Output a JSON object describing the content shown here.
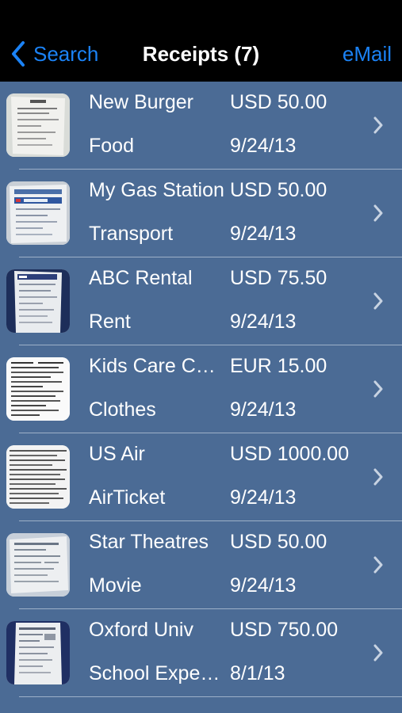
{
  "nav": {
    "back_label": "Search",
    "title": "Receipts (7)",
    "right_label": "eMail"
  },
  "receipts": [
    {
      "merchant": "New Burger",
      "amount": "USD 50.00",
      "category": "Food",
      "date": "9/24/13"
    },
    {
      "merchant": "My Gas Station",
      "amount": "USD 50.00",
      "category": "Transport",
      "date": "9/24/13"
    },
    {
      "merchant": "ABC Rental",
      "amount": "USD 75.50",
      "category": "Rent",
      "date": "9/24/13"
    },
    {
      "merchant": "Kids Care Center",
      "amount": "EUR 15.00",
      "category": "Clothes",
      "date": "9/24/13"
    },
    {
      "merchant": "US Air",
      "amount": "USD 1000.00",
      "category": "AirTicket",
      "date": "9/24/13"
    },
    {
      "merchant": "Star Theatres",
      "amount": "USD 50.00",
      "category": "Movie",
      "date": "9/24/13"
    },
    {
      "merchant": "Oxford Univ",
      "amount": "USD 750.00",
      "category": "School Expenses",
      "date": "8/1/13"
    }
  ],
  "colors": {
    "accent": "#1b82f5",
    "list_background": "#4b6b95",
    "navbar": "#000000"
  },
  "icons": {
    "back": "chevron-left-icon",
    "disclosure": "chevron-right-icon",
    "thumbnail": "receipt-thumbnail"
  }
}
